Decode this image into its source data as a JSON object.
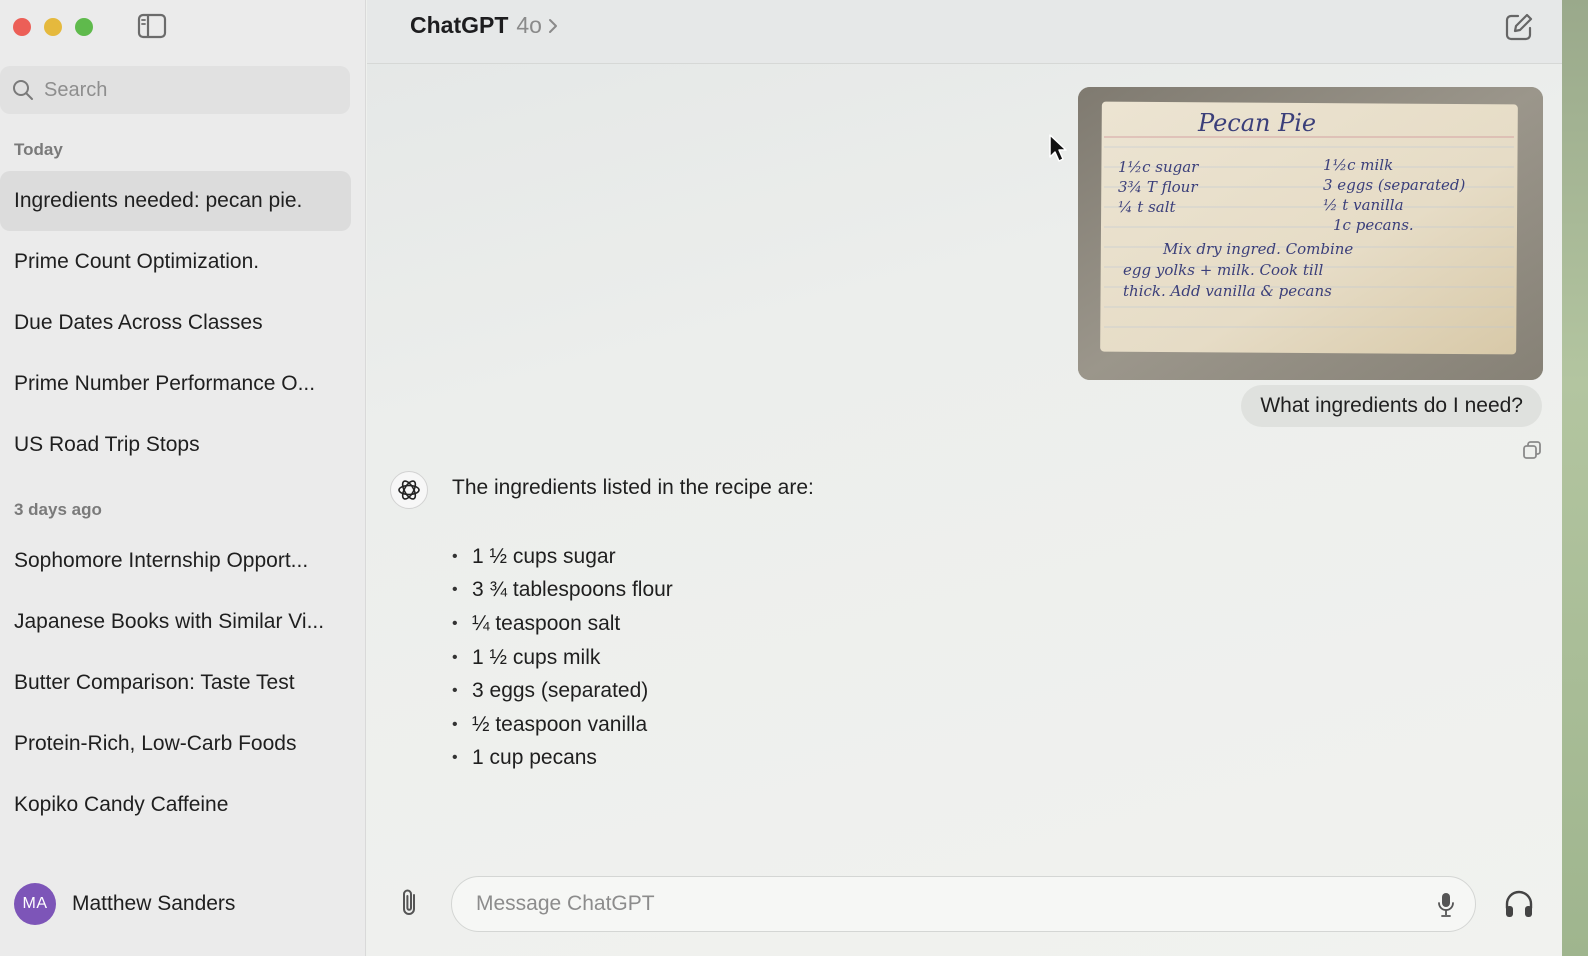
{
  "window": {
    "model_name": "ChatGPT",
    "model_version": "4o"
  },
  "sidebar": {
    "search_placeholder": "Search",
    "groups": [
      {
        "label": "Today",
        "items": [
          {
            "label": "Ingredients needed: pecan pie.",
            "active": true
          },
          {
            "label": "Prime Count Optimization."
          },
          {
            "label": "Due Dates Across Classes"
          },
          {
            "label": "Prime Number Performance O..."
          },
          {
            "label": "US Road Trip Stops"
          }
        ]
      },
      {
        "label": "3 days ago",
        "items": [
          {
            "label": "Sophomore Internship Opport..."
          },
          {
            "label": "Japanese Books with Similar Vi..."
          },
          {
            "label": "Butter Comparison: Taste Test"
          },
          {
            "label": "Protein-Rich, Low-Carb Foods"
          },
          {
            "label": "Kopiko Candy Caffeine"
          }
        ]
      }
    ],
    "user": {
      "initials": "MA",
      "name": "Matthew Sanders",
      "avatar_color": "#7d55b8"
    }
  },
  "conversation": {
    "recipe_image": {
      "title": "Pecan Pie",
      "lines_left": [
        "1½c sugar",
        "3¾ T flour",
        "¼ t salt"
      ],
      "lines_right": [
        "1½c milk",
        "3 eggs (separated)",
        "½ t vanilla",
        "1c pecans."
      ],
      "instructions": [
        "Mix dry ingred. Combine",
        "egg yolks + milk. Cook till",
        "thick. Add vanilla & pecans"
      ]
    },
    "user_message": "What ingredients do I need?",
    "assistant_intro": "The ingredients listed in the recipe are:",
    "ingredients": [
      "1 ½ cups sugar",
      "3 ¾ tablespoons flour",
      "¼ teaspoon salt",
      "1 ½ cups milk",
      "3 eggs (separated)",
      "½ teaspoon vanilla",
      "1 cup pecans"
    ],
    "bullet": "•"
  },
  "composer": {
    "placeholder": "Message ChatGPT"
  },
  "icons": {
    "sidebar_toggle": "sidebar-toggle-icon",
    "new_chat": "compose-icon",
    "copy": "copy-icon",
    "attach": "paperclip-icon",
    "mic": "microphone-icon",
    "voice": "headphones-icon"
  }
}
